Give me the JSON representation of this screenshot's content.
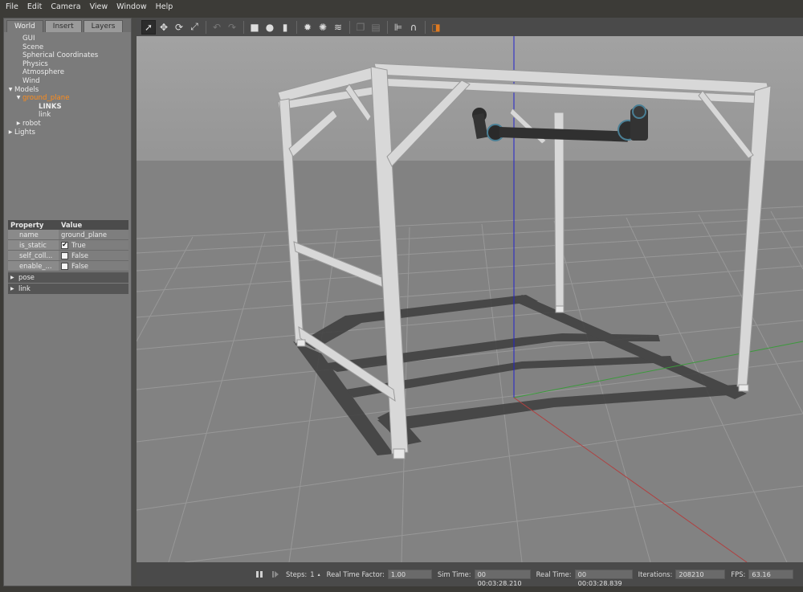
{
  "menubar": {
    "items": [
      "File",
      "Edit",
      "Camera",
      "View",
      "Window",
      "Help"
    ]
  },
  "leftpanel": {
    "tabs": [
      "World",
      "Insert",
      "Layers"
    ],
    "active_tab": "World",
    "tree": [
      {
        "label": "GUI",
        "indent": 1,
        "arrow": ""
      },
      {
        "label": "Scene",
        "indent": 1,
        "arrow": ""
      },
      {
        "label": "Spherical Coordinates",
        "indent": 1,
        "arrow": ""
      },
      {
        "label": "Physics",
        "indent": 1,
        "arrow": ""
      },
      {
        "label": "Atmosphere",
        "indent": 1,
        "arrow": ""
      },
      {
        "label": "Wind",
        "indent": 1,
        "arrow": ""
      },
      {
        "label": "Models",
        "indent": 0,
        "arrow": "down"
      },
      {
        "label": "ground_plane",
        "indent": 1,
        "arrow": "down",
        "selected": true
      },
      {
        "label": "LINKS",
        "indent": 3,
        "arrow": "",
        "bold": true
      },
      {
        "label": "link",
        "indent": 3,
        "arrow": ""
      },
      {
        "label": "robot",
        "indent": 1,
        "arrow": "right"
      },
      {
        "label": "Lights",
        "indent": 0,
        "arrow": "right"
      }
    ]
  },
  "properties": {
    "header": {
      "property": "Property",
      "value": "Value"
    },
    "rows": [
      {
        "key": "name",
        "value": "ground_plane",
        "checkbox": false
      },
      {
        "key": "is_static",
        "value": "True",
        "checkbox": true,
        "checked": true
      },
      {
        "key": "self_coll...",
        "value": "False",
        "checkbox": true,
        "checked": false
      },
      {
        "key": "enable_...",
        "value": "False",
        "checkbox": true,
        "checked": false
      }
    ],
    "groups": [
      "pose",
      "link"
    ]
  },
  "toolbar": {
    "icons": [
      "select-arrow-icon",
      "translate-icon",
      "rotate-icon",
      "scale-icon",
      "undo-icon",
      "redo-icon",
      "box-shape-icon",
      "sphere-shape-icon",
      "cylinder-shape-icon",
      "point-light-icon",
      "spot-light-icon",
      "directional-light-icon",
      "copy-icon",
      "paste-icon",
      "align-icon",
      "snap-icon",
      "change-view-icon"
    ]
  },
  "statusbar": {
    "steps_label": "Steps:",
    "steps_value": "1",
    "rtf_label": "Real Time Factor:",
    "rtf_value": "1.00",
    "simtime_label": "Sim Time:",
    "simtime_value": "00 00:03:28.210",
    "realtime_label": "Real Time:",
    "realtime_value": "00 00:03:28.839",
    "iterations_label": "Iterations:",
    "iterations_value": "208210",
    "fps_label": "FPS:",
    "fps_value": "63.16"
  },
  "colors": {
    "selected_text": "#ff8c1a",
    "sky": "#9b9b9b",
    "ground": "#808080",
    "z_axis": "#2222cc",
    "x_axis": "#b04040",
    "y_axis": "#3c9a3c"
  }
}
